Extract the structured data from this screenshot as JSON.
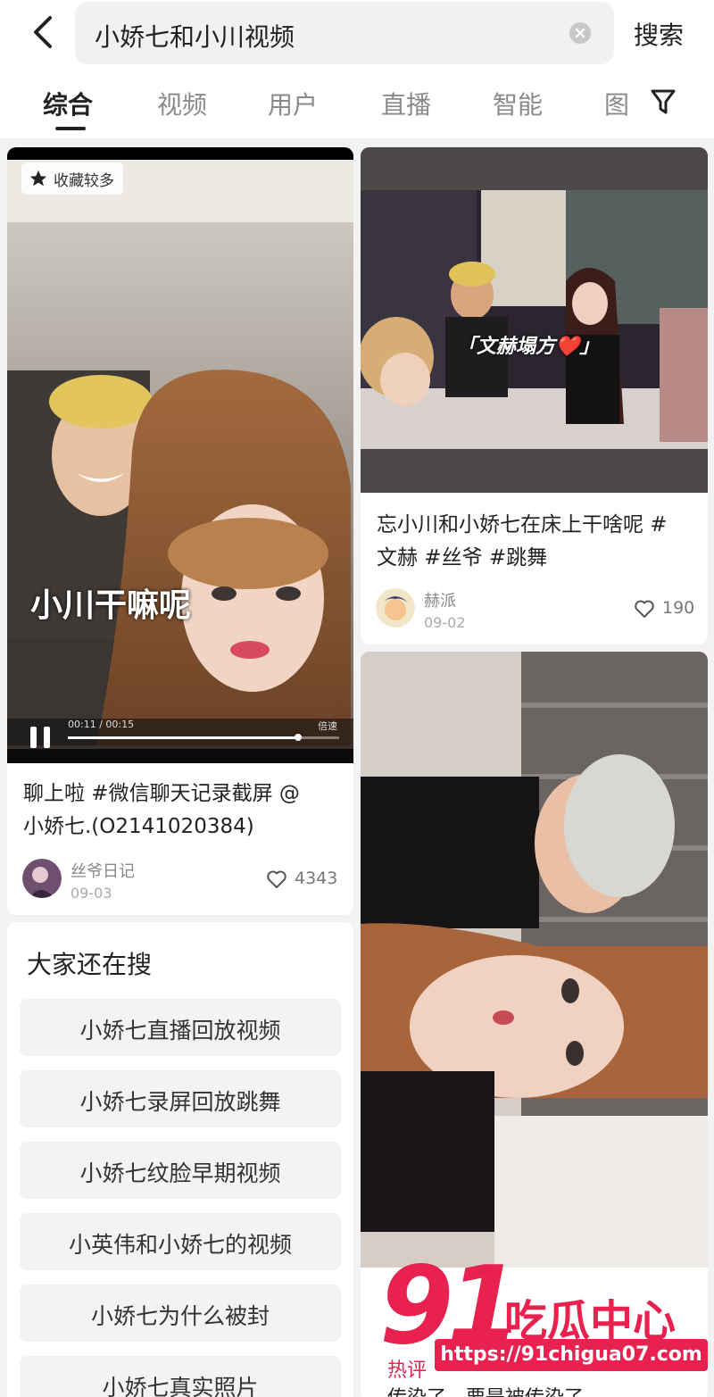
{
  "search": {
    "query": "小娇七和小川视频",
    "button_label": "搜索"
  },
  "tabs": [
    {
      "label": "综合"
    },
    {
      "label": "视频"
    },
    {
      "label": "用户"
    },
    {
      "label": "直播"
    },
    {
      "label": "智能"
    },
    {
      "label": "图"
    }
  ],
  "card1": {
    "badge": "收藏较多",
    "caption": "小川干嘛呢",
    "time": "00:11 / 00:15",
    "speed": "倍速",
    "progress": 0.85,
    "title_line1": "聊上啦 #微信聊天记录截屏 @",
    "title_line2": "小娇七.(O2141020384)",
    "author": "丝爷日记",
    "date": "09-03",
    "likes": "4343"
  },
  "card2": {
    "caption": "「文赫塌方❤️」",
    "title_line1": "忘小川和小娇七在床上干啥呢 #",
    "title_line2": "文赫 #丝爷 #跳舞",
    "author": "赫派",
    "date": "09-02",
    "likes": "190"
  },
  "card3": {
    "hot_comment_label": "热评",
    "comment_tail": "传染了，要是被传染了"
  },
  "suggestions": {
    "title": "大家还在搜",
    "items": [
      "小娇七直播回放视频",
      "小娇七录屏回放跳舞",
      "小娇七纹脸早期视频",
      "小英伟和小娇七的视频",
      "小娇七为什么被封",
      "小娇七真实照片"
    ]
  },
  "watermark": {
    "number": "91",
    "name": "吃瓜中心",
    "url": "https://91chigua07.com"
  },
  "colors": {
    "accent": "#e8214f",
    "tab_active": "#222222",
    "tab_inactive": "#8a8a8a",
    "pill_bg": "#f2f3f5"
  }
}
